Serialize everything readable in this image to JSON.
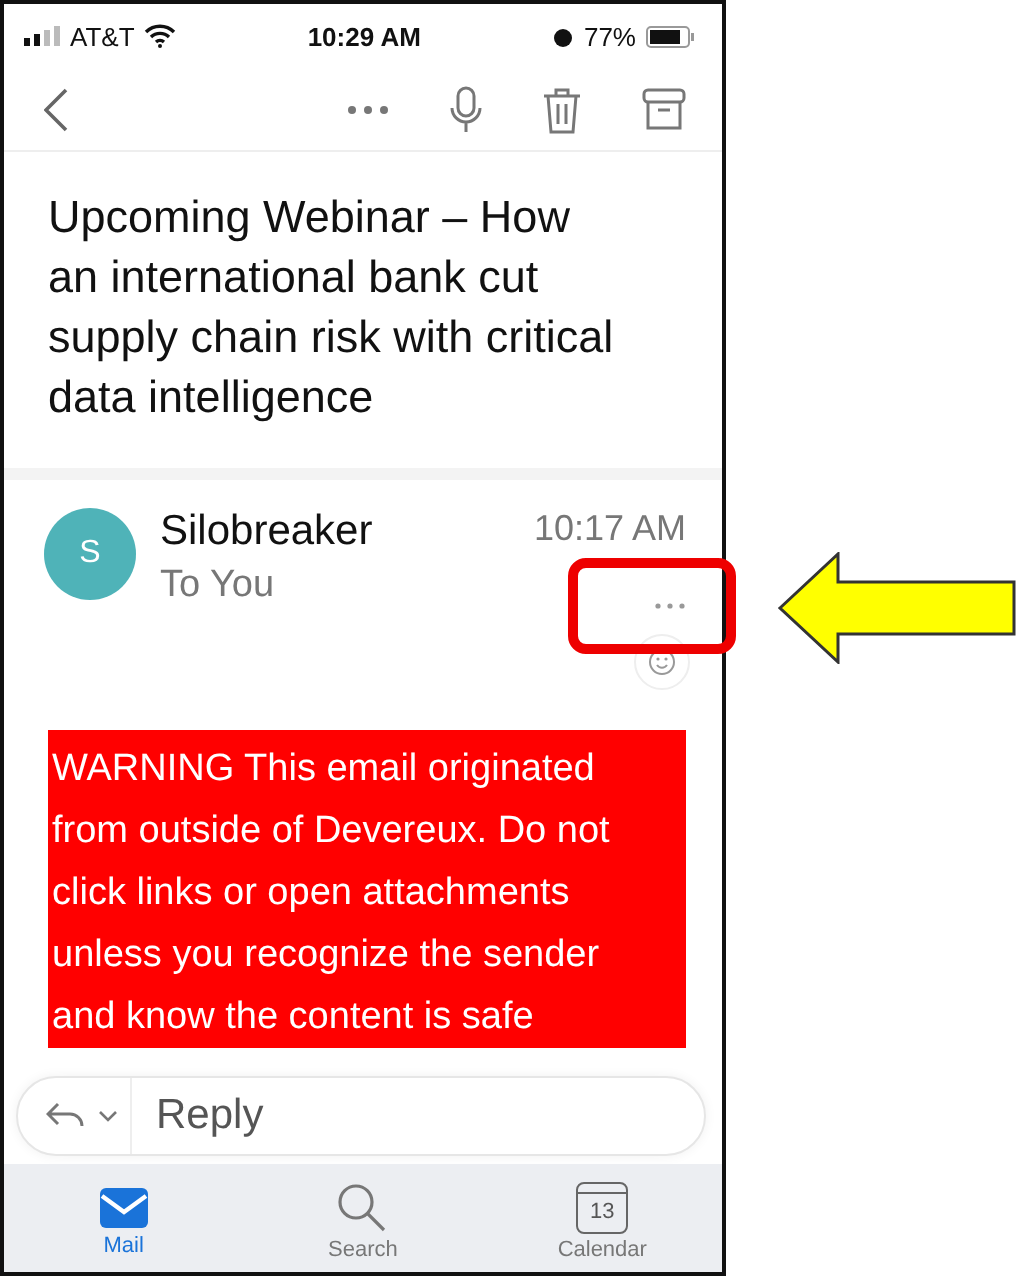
{
  "status_bar": {
    "carrier": "AT&T",
    "time": "10:29 AM",
    "battery": "77%"
  },
  "subject": "Upcoming Webinar – How an international bank cut supply chain risk with critical data intelligence",
  "sender": {
    "initial": "S",
    "name": "Silobreaker",
    "recipient": "To You",
    "time": "10:17 AM"
  },
  "warning": "WARNING This email originated from outside of Devereux. Do not click links or open attachments unless you recognize the sender and know the content is safe",
  "reply": {
    "placeholder": "Reply"
  },
  "tabs": [
    {
      "label": "Mail",
      "kind": "mail",
      "selected": true
    },
    {
      "label": "Search",
      "kind": "search",
      "selected": false
    },
    {
      "label": "Calendar",
      "kind": "calendar",
      "selected": false,
      "day": "13"
    }
  ]
}
